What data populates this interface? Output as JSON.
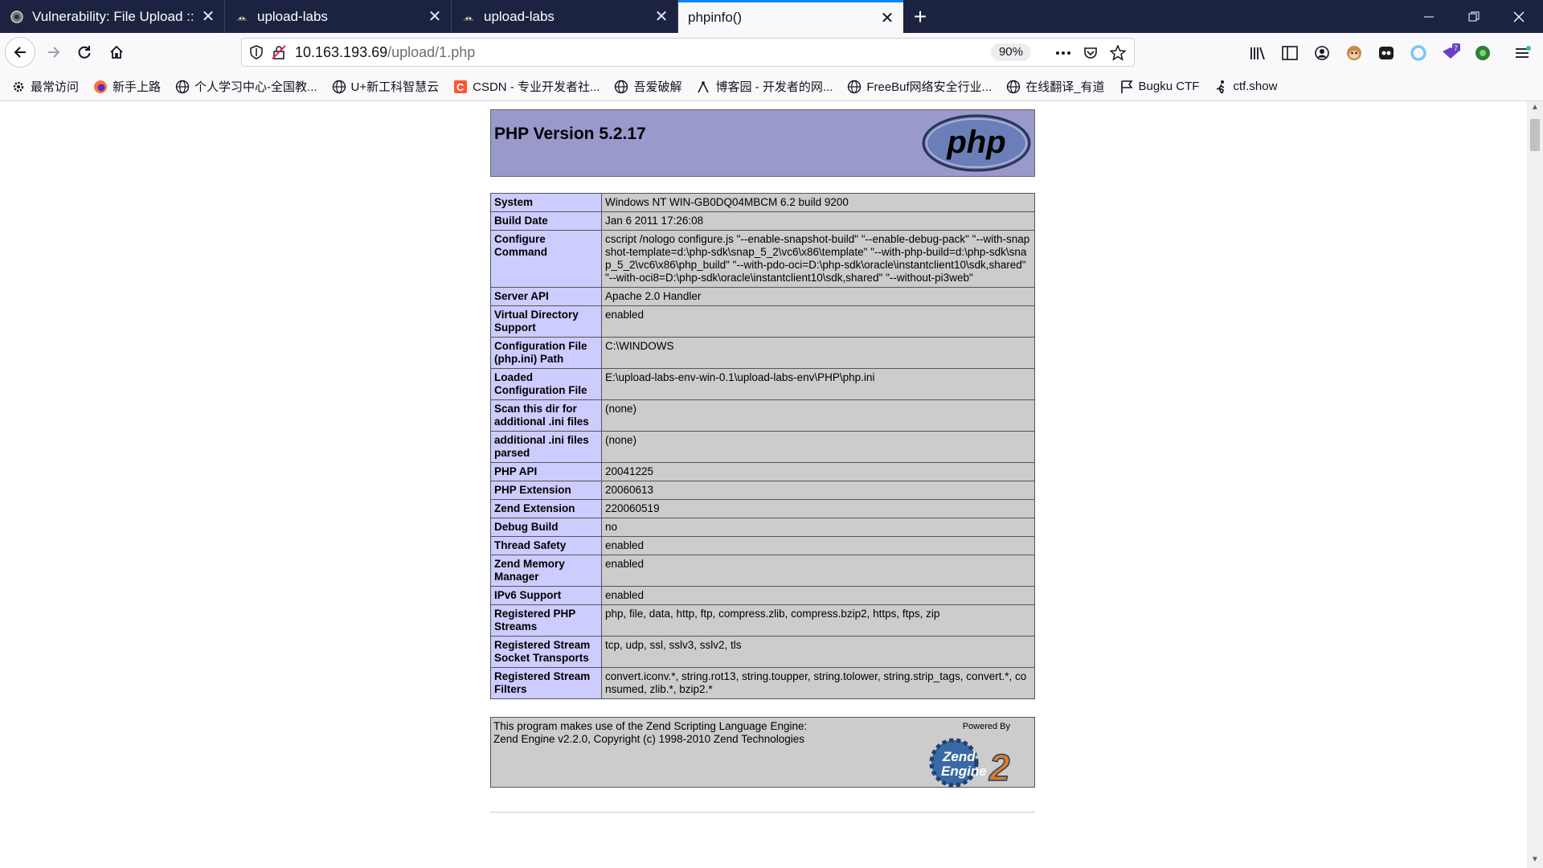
{
  "tabs": [
    {
      "title": "Vulnerability: File Upload :: D",
      "active": false
    },
    {
      "title": "upload-labs",
      "active": false
    },
    {
      "title": "upload-labs",
      "active": false
    },
    {
      "title": "phpinfo()",
      "active": true
    }
  ],
  "urlbar": {
    "host": "10.163.193.69",
    "path": "/upload/1.php",
    "zoom": "90%"
  },
  "bookmarks": [
    {
      "label": "最常访问",
      "icon": "gear-icon"
    },
    {
      "label": "新手上路",
      "icon": "firefox-icon"
    },
    {
      "label": "个人学习中心-全国教...",
      "icon": "globe-icon"
    },
    {
      "label": "U+新工科智慧云",
      "icon": "globe-icon"
    },
    {
      "label": "CSDN - 专业开发者社...",
      "icon": "csdn-icon"
    },
    {
      "label": "吾爱破解",
      "icon": "globe-icon"
    },
    {
      "label": "博客园 - 开发者的网...",
      "icon": "cnblogs-icon"
    },
    {
      "label": "FreeBuf网络安全行业...",
      "icon": "globe-icon"
    },
    {
      "label": "在线翻译_有道",
      "icon": "globe-icon"
    },
    {
      "label": "Bugku CTF",
      "icon": "flag-icon"
    },
    {
      "label": "ctf.show",
      "icon": "runner-icon"
    }
  ],
  "phpinfo": {
    "title": "PHP Version 5.2.17",
    "rows": [
      {
        "key": "System",
        "value": "Windows NT WIN-GB0DQ04MBCM 6.2 build 9200"
      },
      {
        "key": "Build Date",
        "value": "Jan 6 2011 17:26:08"
      },
      {
        "key": "Configure Command",
        "value": "cscript /nologo configure.js \"--enable-snapshot-build\" \"--enable-debug-pack\" \"--with-snapshot-template=d:\\php-sdk\\snap_5_2\\vc6\\x86\\template\" \"--with-php-build=d:\\php-sdk\\snap_5_2\\vc6\\x86\\php_build\" \"--with-pdo-oci=D:\\php-sdk\\oracle\\instantclient10\\sdk,shared\" \"--with-oci8=D:\\php-sdk\\oracle\\instantclient10\\sdk,shared\" \"--without-pi3web\""
      },
      {
        "key": "Server API",
        "value": "Apache 2.0 Handler"
      },
      {
        "key": "Virtual Directory Support",
        "value": "enabled"
      },
      {
        "key": "Configuration File (php.ini) Path",
        "value": "C:\\WINDOWS"
      },
      {
        "key": "Loaded Configuration File",
        "value": "E:\\upload-labs-env-win-0.1\\upload-labs-env\\PHP\\php.ini"
      },
      {
        "key": "Scan this dir for additional .ini files",
        "value": "(none)"
      },
      {
        "key": "additional .ini files parsed",
        "value": "(none)"
      },
      {
        "key": "PHP API",
        "value": "20041225"
      },
      {
        "key": "PHP Extension",
        "value": "20060613"
      },
      {
        "key": "Zend Extension",
        "value": "220060519"
      },
      {
        "key": "Debug Build",
        "value": "no"
      },
      {
        "key": "Thread Safety",
        "value": "enabled"
      },
      {
        "key": "Zend Memory Manager",
        "value": "enabled"
      },
      {
        "key": "IPv6 Support",
        "value": "enabled"
      },
      {
        "key": "Registered PHP Streams",
        "value": "php, file, data, http, ftp, compress.zlib, compress.bzip2, https, ftps, zip"
      },
      {
        "key": "Registered Stream Socket Transports",
        "value": "tcp, udp, ssl, sslv3, sslv2, tls"
      },
      {
        "key": "Registered Stream Filters",
        "value": "convert.iconv.*, string.rot13, string.toupper, string.tolower, string.strip_tags, convert.*, consumed, zlib.*, bzip2.*"
      }
    ],
    "zend": {
      "line1": "This program makes use of the Zend Scripting Language Engine:",
      "line2": "Zend Engine v2.2.0, Copyright (c) 1998-2010 Zend Technologies",
      "powered": "Powered By"
    }
  },
  "colors": {
    "tabbar": "#1c2340",
    "header": "#9999cc",
    "key_cell": "#ccccff",
    "value_cell": "#cccccc"
  }
}
